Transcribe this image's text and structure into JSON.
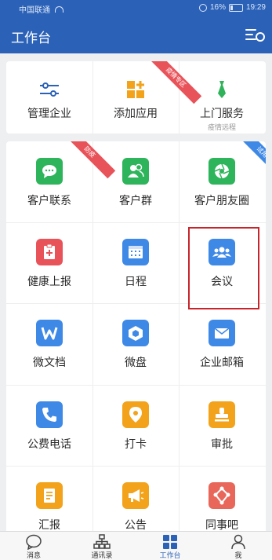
{
  "status_bar": {
    "carrier": "中国联通",
    "battery": "16%",
    "time": "19:29"
  },
  "header": {
    "title": "工作台"
  },
  "top_row": [
    {
      "label": "管理企业",
      "icon": "sliders-icon",
      "color": "#2b62b8"
    },
    {
      "label": "添加应用",
      "icon": "add-apps-icon",
      "color": "#f2a31b",
      "ribbon": "疫情专区"
    },
    {
      "label": "上门服务",
      "sublabel": "疫情远程",
      "icon": "tie-icon",
      "color": "#2fb25a"
    }
  ],
  "apps": [
    {
      "label": "客户联系",
      "icon": "chat-bubble-icon",
      "color": "#2eb45b"
    },
    {
      "label": "客户群",
      "icon": "customer-group-icon",
      "color": "#2eb45b"
    },
    {
      "label": "客户朋友圈",
      "icon": "aperture-icon",
      "color": "#2eb45b",
      "ribbon": "试用"
    },
    {
      "label": "健康上报",
      "icon": "clipboard-plus-icon",
      "color": "#e8535a",
      "ribbon": "防疫"
    },
    {
      "label": "日程",
      "icon": "calendar-icon",
      "color": "#3f89e6"
    },
    {
      "label": "会议",
      "icon": "meeting-people-icon",
      "color": "#3f89e6"
    },
    {
      "label": "微文档",
      "icon": "word-doc-icon",
      "color": "#3f89e6"
    },
    {
      "label": "微盘",
      "icon": "cube-drive-icon",
      "color": "#3f89e6"
    },
    {
      "label": "企业邮箱",
      "icon": "envelope-icon",
      "color": "#3f89e6"
    },
    {
      "label": "公费电话",
      "icon": "phone-icon",
      "color": "#3f89e6"
    },
    {
      "label": "打卡",
      "icon": "location-pin-icon",
      "color": "#f2a31b"
    },
    {
      "label": "审批",
      "icon": "stamp-icon",
      "color": "#f2a31b"
    },
    {
      "label": "汇报",
      "icon": "report-doc-icon",
      "color": "#f2a31b"
    },
    {
      "label": "公告",
      "icon": "megaphone-icon",
      "color": "#f2a31b"
    },
    {
      "label": "同事吧",
      "icon": "share-nodes-icon",
      "color": "#e8675a"
    }
  ],
  "tabbar": [
    {
      "label": "消息",
      "icon": "chat-outline-icon"
    },
    {
      "label": "通讯录",
      "icon": "org-chart-icon"
    },
    {
      "label": "工作台",
      "icon": "grid-icon",
      "active": true
    },
    {
      "label": "我",
      "icon": "person-icon"
    }
  ]
}
